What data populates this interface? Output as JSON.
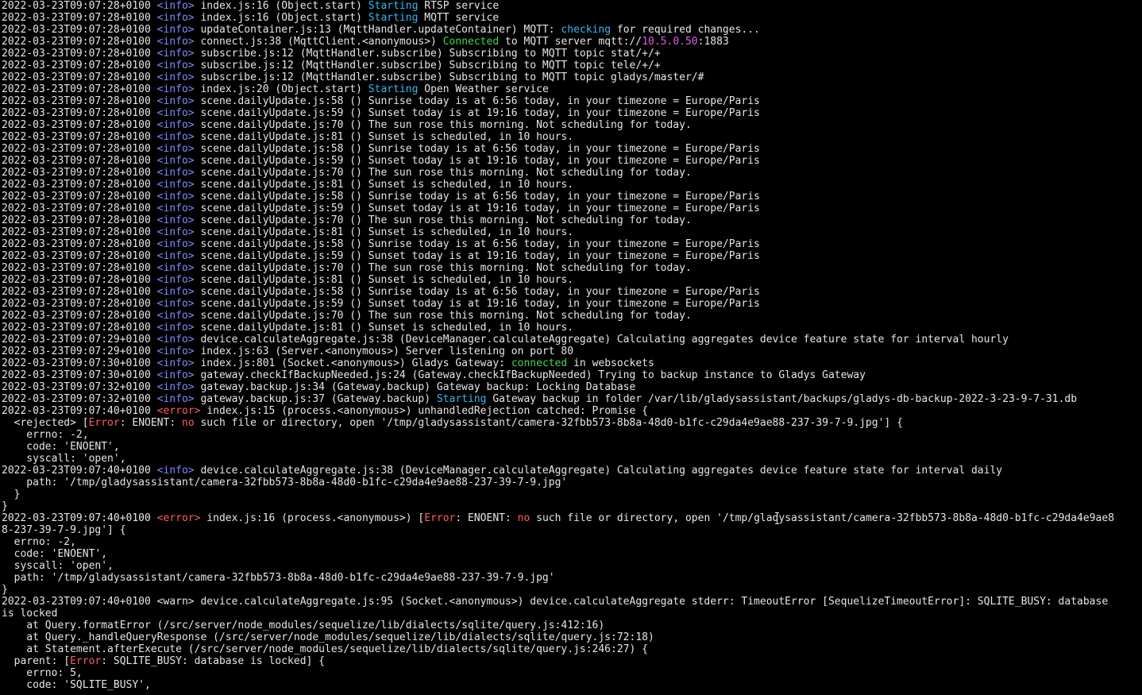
{
  "terminal": {
    "title": "",
    "colors": {
      "background": "#000000",
      "text": "#e6e6e6",
      "info": "#7f8bff",
      "error": "#ff5d5d",
      "green": "#3fd74b",
      "cyan": "#35b8f0",
      "magenta": "#e05ee0"
    },
    "lines": [
      [
        {
          "t": "2022-03-23T09:07:28+0100 ",
          "c": "default"
        },
        {
          "t": "<info>",
          "c": "info"
        },
        {
          "t": " index.js:16 (Object.start) ",
          "c": "default"
        },
        {
          "t": "Starting",
          "c": "cyan"
        },
        {
          "t": " RTSP service",
          "c": "default"
        }
      ],
      [
        {
          "t": "2022-03-23T09:07:28+0100 ",
          "c": "default"
        },
        {
          "t": "<info>",
          "c": "info"
        },
        {
          "t": " index.js:16 (Object.start) ",
          "c": "default"
        },
        {
          "t": "Starting",
          "c": "cyan"
        },
        {
          "t": " MQTT service",
          "c": "default"
        }
      ],
      [
        {
          "t": "2022-03-23T09:07:28+0100 ",
          "c": "default"
        },
        {
          "t": "<info>",
          "c": "info"
        },
        {
          "t": " updateContainer.js:13 (MqttHandler.updateContainer) MQTT: ",
          "c": "default"
        },
        {
          "t": "checking",
          "c": "cyan"
        },
        {
          "t": " for required changes...",
          "c": "default"
        }
      ],
      [
        {
          "t": "2022-03-23T09:07:28+0100 ",
          "c": "default"
        },
        {
          "t": "<info>",
          "c": "info"
        },
        {
          "t": " connect.js:38 (MqttClient.<anonymous>) ",
          "c": "default"
        },
        {
          "t": "Connected",
          "c": "green"
        },
        {
          "t": " to MQTT server mqtt://",
          "c": "default"
        },
        {
          "t": "10.5.0.50",
          "c": "magenta"
        },
        {
          "t": ":1883",
          "c": "default"
        }
      ],
      [
        {
          "t": "2022-03-23T09:07:28+0100 ",
          "c": "default"
        },
        {
          "t": "<info>",
          "c": "info"
        },
        {
          "t": " subscribe.js:12 (MqttHandler.subscribe) Subscribing to MQTT topic stat/+/+",
          "c": "default"
        }
      ],
      [
        {
          "t": "2022-03-23T09:07:28+0100 ",
          "c": "default"
        },
        {
          "t": "<info>",
          "c": "info"
        },
        {
          "t": " subscribe.js:12 (MqttHandler.subscribe) Subscribing to MQTT topic tele/+/+",
          "c": "default"
        }
      ],
      [
        {
          "t": "2022-03-23T09:07:28+0100 ",
          "c": "default"
        },
        {
          "t": "<info>",
          "c": "info"
        },
        {
          "t": " subscribe.js:12 (MqttHandler.subscribe) Subscribing to MQTT topic gladys/master/#",
          "c": "default"
        }
      ],
      [
        {
          "t": "2022-03-23T09:07:28+0100 ",
          "c": "default"
        },
        {
          "t": "<info>",
          "c": "info"
        },
        {
          "t": " index.js:20 (Object.start) ",
          "c": "default"
        },
        {
          "t": "Starting",
          "c": "cyan"
        },
        {
          "t": " Open Weather service",
          "c": "default"
        }
      ],
      [
        {
          "t": "2022-03-23T09:07:28+0100 ",
          "c": "default"
        },
        {
          "t": "<info>",
          "c": "info"
        },
        {
          "t": " scene.dailyUpdate.js:58 () Sunrise today is at 6:56 today, in your timezone = Europe/Paris",
          "c": "default"
        }
      ],
      [
        {
          "t": "2022-03-23T09:07:28+0100 ",
          "c": "default"
        },
        {
          "t": "<info>",
          "c": "info"
        },
        {
          "t": " scene.dailyUpdate.js:59 () Sunset today is at 19:16 today, in your timezone = Europe/Paris",
          "c": "default"
        }
      ],
      [
        {
          "t": "2022-03-23T09:07:28+0100 ",
          "c": "default"
        },
        {
          "t": "<info>",
          "c": "info"
        },
        {
          "t": " scene.dailyUpdate.js:70 () The sun rose this morning. Not scheduling for today.",
          "c": "default"
        }
      ],
      [
        {
          "t": "2022-03-23T09:07:28+0100 ",
          "c": "default"
        },
        {
          "t": "<info>",
          "c": "info"
        },
        {
          "t": " scene.dailyUpdate.js:81 () Sunset is scheduled, in 10 hours.",
          "c": "default"
        }
      ],
      [
        {
          "t": "2022-03-23T09:07:28+0100 ",
          "c": "default"
        },
        {
          "t": "<info>",
          "c": "info"
        },
        {
          "t": " scene.dailyUpdate.js:58 () Sunrise today is at 6:56 today, in your timezone = Europe/Paris",
          "c": "default"
        }
      ],
      [
        {
          "t": "2022-03-23T09:07:28+0100 ",
          "c": "default"
        },
        {
          "t": "<info>",
          "c": "info"
        },
        {
          "t": " scene.dailyUpdate.js:59 () Sunset today is at 19:16 today, in your timezone = Europe/Paris",
          "c": "default"
        }
      ],
      [
        {
          "t": "2022-03-23T09:07:28+0100 ",
          "c": "default"
        },
        {
          "t": "<info>",
          "c": "info"
        },
        {
          "t": " scene.dailyUpdate.js:70 () The sun rose this morning. Not scheduling for today.",
          "c": "default"
        }
      ],
      [
        {
          "t": "2022-03-23T09:07:28+0100 ",
          "c": "default"
        },
        {
          "t": "<info>",
          "c": "info"
        },
        {
          "t": " scene.dailyUpdate.js:81 () Sunset is scheduled, in 10 hours.",
          "c": "default"
        }
      ],
      [
        {
          "t": "2022-03-23T09:07:28+0100 ",
          "c": "default"
        },
        {
          "t": "<info>",
          "c": "info"
        },
        {
          "t": " scene.dailyUpdate.js:58 () Sunrise today is at 6:56 today, in your timezone = Europe/Paris",
          "c": "default"
        }
      ],
      [
        {
          "t": "2022-03-23T09:07:28+0100 ",
          "c": "default"
        },
        {
          "t": "<info>",
          "c": "info"
        },
        {
          "t": " scene.dailyUpdate.js:59 () Sunset today is at 19:16 today, in your timezone = Europe/Paris",
          "c": "default"
        }
      ],
      [
        {
          "t": "2022-03-23T09:07:28+0100 ",
          "c": "default"
        },
        {
          "t": "<info>",
          "c": "info"
        },
        {
          "t": " scene.dailyUpdate.js:70 () The sun rose this morning. Not scheduling for today.",
          "c": "default"
        }
      ],
      [
        {
          "t": "2022-03-23T09:07:28+0100 ",
          "c": "default"
        },
        {
          "t": "<info>",
          "c": "info"
        },
        {
          "t": " scene.dailyUpdate.js:81 () Sunset is scheduled, in 10 hours.",
          "c": "default"
        }
      ],
      [
        {
          "t": "2022-03-23T09:07:28+0100 ",
          "c": "default"
        },
        {
          "t": "<info>",
          "c": "info"
        },
        {
          "t": " scene.dailyUpdate.js:58 () Sunrise today is at 6:56 today, in your timezone = Europe/Paris",
          "c": "default"
        }
      ],
      [
        {
          "t": "2022-03-23T09:07:28+0100 ",
          "c": "default"
        },
        {
          "t": "<info>",
          "c": "info"
        },
        {
          "t": " scene.dailyUpdate.js:59 () Sunset today is at 19:16 today, in your timezone = Europe/Paris",
          "c": "default"
        }
      ],
      [
        {
          "t": "2022-03-23T09:07:28+0100 ",
          "c": "default"
        },
        {
          "t": "<info>",
          "c": "info"
        },
        {
          "t": " scene.dailyUpdate.js:70 () The sun rose this morning. Not scheduling for today.",
          "c": "default"
        }
      ],
      [
        {
          "t": "2022-03-23T09:07:28+0100 ",
          "c": "default"
        },
        {
          "t": "<info>",
          "c": "info"
        },
        {
          "t": " scene.dailyUpdate.js:81 () Sunset is scheduled, in 10 hours.",
          "c": "default"
        }
      ],
      [
        {
          "t": "2022-03-23T09:07:28+0100 ",
          "c": "default"
        },
        {
          "t": "<info>",
          "c": "info"
        },
        {
          "t": " scene.dailyUpdate.js:58 () Sunrise today is at 6:56 today, in your timezone = Europe/Paris",
          "c": "default"
        }
      ],
      [
        {
          "t": "2022-03-23T09:07:28+0100 ",
          "c": "default"
        },
        {
          "t": "<info>",
          "c": "info"
        },
        {
          "t": " scene.dailyUpdate.js:59 () Sunset today is at 19:16 today, in your timezone = Europe/Paris",
          "c": "default"
        }
      ],
      [
        {
          "t": "2022-03-23T09:07:28+0100 ",
          "c": "default"
        },
        {
          "t": "<info>",
          "c": "info"
        },
        {
          "t": " scene.dailyUpdate.js:70 () The sun rose this morning. Not scheduling for today.",
          "c": "default"
        }
      ],
      [
        {
          "t": "2022-03-23T09:07:28+0100 ",
          "c": "default"
        },
        {
          "t": "<info>",
          "c": "info"
        },
        {
          "t": " scene.dailyUpdate.js:81 () Sunset is scheduled, in 10 hours.",
          "c": "default"
        }
      ],
      [
        {
          "t": "2022-03-23T09:07:29+0100 ",
          "c": "default"
        },
        {
          "t": "<info>",
          "c": "info"
        },
        {
          "t": " device.calculateAggregate.js:38 (DeviceManager.calculateAggregate) Calculating aggregates device feature state for interval hourly",
          "c": "default"
        }
      ],
      [
        {
          "t": "2022-03-23T09:07:29+0100 ",
          "c": "default"
        },
        {
          "t": "<info>",
          "c": "info"
        },
        {
          "t": " index.js:63 (Server.<anonymous>) Server listening on port 80",
          "c": "default"
        }
      ],
      [
        {
          "t": "2022-03-23T09:07:30+0100 ",
          "c": "default"
        },
        {
          "t": "<info>",
          "c": "info"
        },
        {
          "t": " index.js:801 (Socket.<anonymous>) Gladys Gateway: ",
          "c": "default"
        },
        {
          "t": "connected",
          "c": "green"
        },
        {
          "t": " in websockets",
          "c": "default"
        }
      ],
      [
        {
          "t": "2022-03-23T09:07:30+0100 ",
          "c": "default"
        },
        {
          "t": "<info>",
          "c": "info"
        },
        {
          "t": " gateway.checkIfBackupNeeded.js:24 (Gateway.checkIfBackupNeeded) Trying to backup instance to Gladys Gateway",
          "c": "default"
        }
      ],
      [
        {
          "t": "2022-03-23T09:07:32+0100 ",
          "c": "default"
        },
        {
          "t": "<info>",
          "c": "info"
        },
        {
          "t": " gateway.backup.js:34 (Gateway.backup) Gateway backup: Locking Database",
          "c": "default"
        }
      ],
      [
        {
          "t": "2022-03-23T09:07:32+0100 ",
          "c": "default"
        },
        {
          "t": "<info>",
          "c": "info"
        },
        {
          "t": " gateway.backup.js:37 (Gateway.backup) ",
          "c": "default"
        },
        {
          "t": "Starting",
          "c": "cyan"
        },
        {
          "t": " Gateway backup in folder /var/lib/gladysassistant/backups/gladys-db-backup-2022-3-23-9-7-31.db",
          "c": "default"
        }
      ],
      [
        {
          "t": "2022-03-23T09:07:40+0100 ",
          "c": "default"
        },
        {
          "t": "<error>",
          "c": "error"
        },
        {
          "t": " index.js:15 (process.<anonymous>) unhandledRejection catched: Promise {",
          "c": "default"
        }
      ],
      [
        {
          "t": "  <rejected> [",
          "c": "default"
        },
        {
          "t": "Error",
          "c": "red"
        },
        {
          "t": ": ENOENT: ",
          "c": "default"
        },
        {
          "t": "no",
          "c": "red"
        },
        {
          "t": " such file or directory, open '/tmp/gladysassistant/camera-32fbb573-8b8a-48d0-b1fc-c29da4e9ae88-237-39-7-9.jpg'] {",
          "c": "default"
        }
      ],
      [
        {
          "t": "    errno: -2,",
          "c": "default"
        }
      ],
      [
        {
          "t": "    code: 'ENOENT',",
          "c": "default"
        }
      ],
      [
        {
          "t": "    syscall: 'open',",
          "c": "default"
        }
      ],
      [
        {
          "t": "2022-03-23T09:07:40+0100 ",
          "c": "default"
        },
        {
          "t": "<info>",
          "c": "info"
        },
        {
          "t": " device.calculateAggregate.js:38 (DeviceManager.calculateAggregate) Calculating aggregates device feature state for interval daily",
          "c": "default"
        }
      ],
      [
        {
          "t": "    path: '/tmp/gladysassistant/camera-32fbb573-8b8a-48d0-b1fc-c29da4e9ae88-237-39-7-9.jpg'",
          "c": "default"
        }
      ],
      [
        {
          "t": "  }",
          "c": "default"
        }
      ],
      [
        {
          "t": "}",
          "c": "default"
        }
      ],
      [
        {
          "t": "2022-03-23T09:07:40+0100 ",
          "c": "default"
        },
        {
          "t": "<error>",
          "c": "error"
        },
        {
          "t": " index.js:16 (process.<anonymous>) [",
          "c": "default"
        },
        {
          "t": "Error",
          "c": "red"
        },
        {
          "t": ": ENOENT: ",
          "c": "default"
        },
        {
          "t": "no",
          "c": "red"
        },
        {
          "t": " such file or directory, open '/tmp/gladysassistant/camera-32fbb573-8b8a-48d0-b1fc-c29da4e9ae8",
          "c": "default"
        }
      ],
      [
        {
          "t": "8-237-39-7-9.jpg'] {",
          "c": "default"
        }
      ],
      [
        {
          "t": "  errno: -2,",
          "c": "default"
        }
      ],
      [
        {
          "t": "  code: 'ENOENT',",
          "c": "default"
        }
      ],
      [
        {
          "t": "  syscall: 'open',",
          "c": "default"
        }
      ],
      [
        {
          "t": "  path: '/tmp/gladysassistant/camera-32fbb573-8b8a-48d0-b1fc-c29da4e9ae88-237-39-7-9.jpg'",
          "c": "default"
        }
      ],
      [
        {
          "t": "}",
          "c": "default"
        }
      ],
      [
        {
          "t": "2022-03-23T09:07:40+0100 ",
          "c": "default"
        },
        {
          "t": "<warn>",
          "c": "warn"
        },
        {
          "t": " device.calculateAggregate.js:95 (Socket.<anonymous>) device.calculateAggregate stderr: TimeoutError [SequelizeTimeoutError]: SQLITE_BUSY: database",
          "c": "default"
        }
      ],
      [
        {
          "t": "is locked",
          "c": "default"
        }
      ],
      [
        {
          "t": "    at Query.formatError (/src/server/node_modules/sequelize/lib/dialects/sqlite/query.js:412:16)",
          "c": "default"
        }
      ],
      [
        {
          "t": "    at Query._handleQueryResponse (/src/server/node_modules/sequelize/lib/dialects/sqlite/query.js:72:18)",
          "c": "default"
        }
      ],
      [
        {
          "t": "    at Statement.afterExecute (/src/server/node_modules/sequelize/lib/dialects/sqlite/query.js:246:27) {",
          "c": "default"
        }
      ],
      [
        {
          "t": "  parent: [",
          "c": "default"
        },
        {
          "t": "Error",
          "c": "red"
        },
        {
          "t": ": SQLITE_BUSY: database is locked] {",
          "c": "default"
        }
      ],
      [
        {
          "t": "    errno: 5,",
          "c": "default"
        }
      ],
      [
        {
          "t": "    code: 'SQLITE_BUSY',",
          "c": "default"
        }
      ]
    ]
  }
}
